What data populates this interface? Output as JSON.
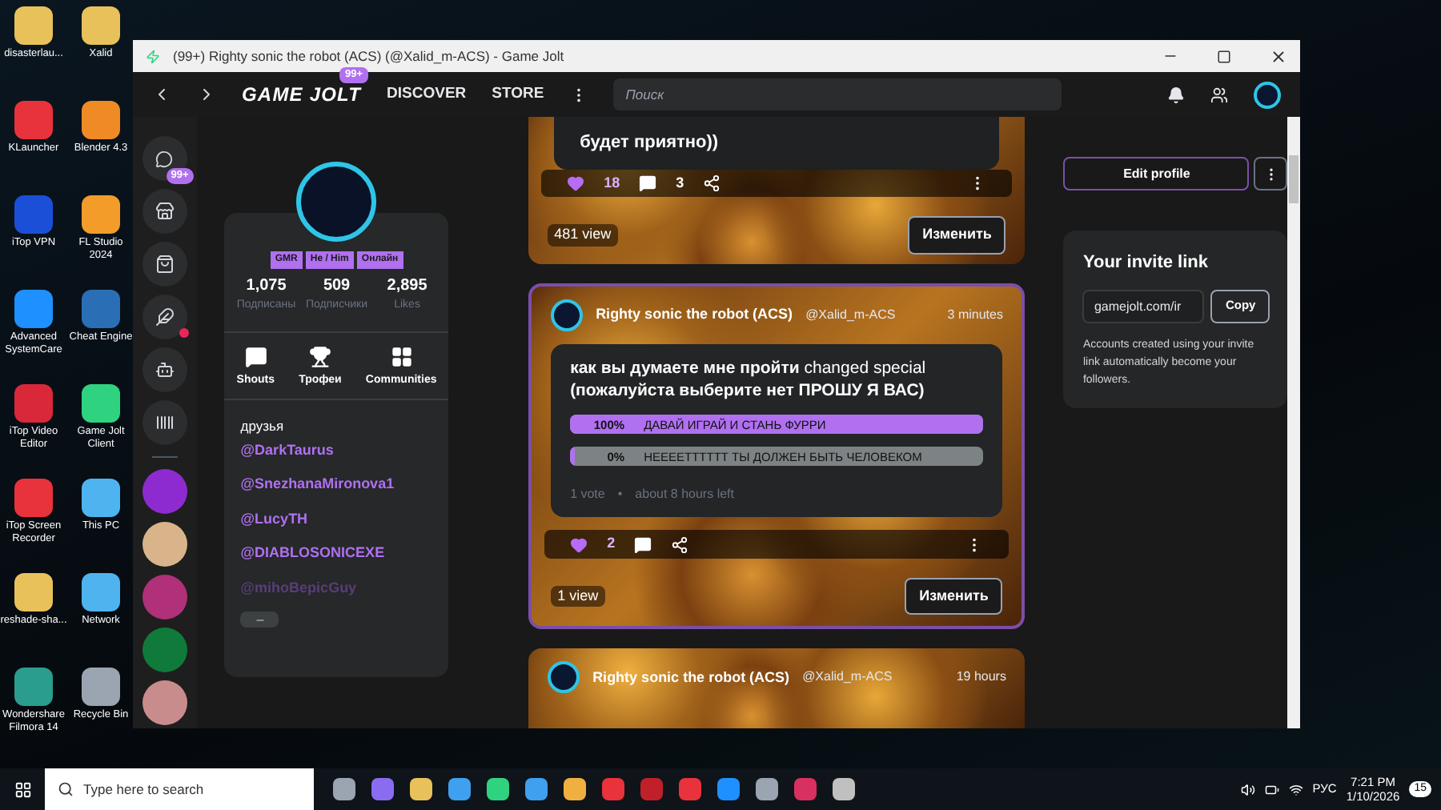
{
  "desktop_icons": [
    {
      "label": "disasterlau..."
    },
    {
      "label": "Xalid"
    },
    {
      "label": "KLauncher"
    },
    {
      "label": "Blender 4.3"
    },
    {
      "label": "iTop VPN"
    },
    {
      "label": "FL Studio 2024"
    },
    {
      "label": "Advanced SystemCare"
    },
    {
      "label": "Cheat Engine"
    },
    {
      "label": "iTop Video Editor"
    },
    {
      "label": "Game Jolt Client"
    },
    {
      "label": "iTop Screen Recorder"
    },
    {
      "label": "This PC"
    },
    {
      "label": "reshade-sha..."
    },
    {
      "label": "Network"
    },
    {
      "label": "Wondershare Filmora 14"
    },
    {
      "label": "Recycle Bin"
    }
  ],
  "window": {
    "title": "(99+) Righty sonic the robot (ACS) (@Xalid_m-ACS) - Game Jolt"
  },
  "nav": {
    "logo": "GAME JOLT",
    "logo_badge": "99+",
    "links": [
      "DISCOVER",
      "STORE"
    ],
    "search": {
      "placeholder": "Поиск"
    }
  },
  "rail": {
    "chat_badge": "99+"
  },
  "profile": {
    "tags": [
      "GMR",
      "He / Him",
      "Онлайн"
    ],
    "stats": [
      {
        "value": "1,075",
        "label": "Подписаны"
      },
      {
        "value": "509",
        "label": "Подписчики"
      },
      {
        "value": "2,895",
        "label": "Likes"
      }
    ],
    "tabs": [
      "Shouts",
      "Трофеи",
      "Communities"
    ],
    "friends_title": "друзья",
    "friends": [
      {
        "handle": "@DarkTaurus",
        "faded": false
      },
      {
        "handle": "@SnezhanaMironova1",
        "faded": false
      },
      {
        "handle": "@LucyTH",
        "faded": false
      },
      {
        "handle": "@DIABLOSONICEXE",
        "faded": false
      },
      {
        "handle": "@mihoBepicGuy",
        "faded": true
      }
    ]
  },
  "posts": [
    {
      "kind": "tail",
      "text": "будет приятно))",
      "liked": true,
      "likes": "18",
      "comments": "3",
      "views": "481 view",
      "edit": "Изменить"
    },
    {
      "kind": "poll",
      "author": "Righty sonic the robot (ACS)",
      "handle": "@Xalid_m-ACS",
      "time": "3 minutes",
      "title": "**как вы думаете мне пройти** changed special **(пожалуйста выберите нет ПРОШУ Я ВАС)**",
      "options": [
        {
          "percent": "100%",
          "label": "ДАВАЙ ИГРАЙ И СТАНЬ ФУРРИ",
          "level": 1
        },
        {
          "percent": "0%",
          "label": "НЕЕЕЕТТТТТТ ТЫ ДОЛЖЕН БЫТЬ ЧЕЛОВЕКОМ",
          "level": 0
        }
      ],
      "votes": "1 vote",
      "separator": "•",
      "remaining": "about 8 hours left",
      "liked": true,
      "likes": "2",
      "views": "1 view",
      "edit": "Изменить"
    },
    {
      "kind": "header",
      "author": "Righty sonic the robot (ACS)",
      "handle": "@Xalid_m-ACS",
      "time": "19 hours"
    }
  ],
  "sidebar": {
    "edit_profile": "Edit profile",
    "invite_title": "Your invite link",
    "invite_value": "gamejolt.com/ir",
    "copy": "Copy",
    "invite_text": "Accounts created using your invite link automatically become your followers."
  },
  "taskbar": {
    "search_placeholder": "Type here to search",
    "language": "РУС",
    "time": "7:21 PM",
    "date": "1/10/2026",
    "notifications": "15"
  }
}
